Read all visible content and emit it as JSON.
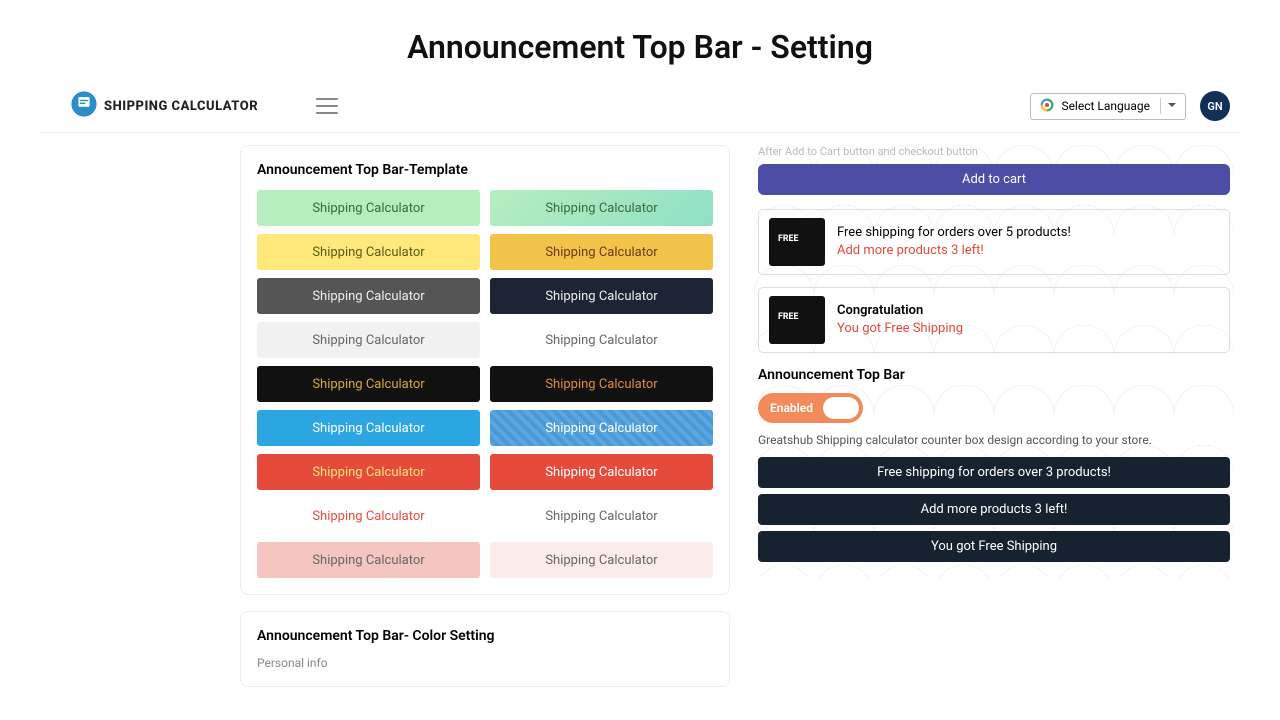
{
  "page_title": "Announcement Top Bar - Setting",
  "header": {
    "logo_text": "Shipping Calculator",
    "lang_label": "Select Language",
    "avatar_initials": "GN"
  },
  "template_card": {
    "title": "Announcement Top Bar-Template",
    "items": [
      {
        "label": "Shipping Calculator"
      },
      {
        "label": "Shipping Calculator"
      },
      {
        "label": "Shipping Calculator"
      },
      {
        "label": "Shipping Calculator"
      },
      {
        "label": "Shipping Calculator"
      },
      {
        "label": "Shipping Calculator"
      },
      {
        "label": "Shipping Calculator"
      },
      {
        "label": "Shipping Calculator"
      },
      {
        "label": "Shipping Calculator"
      },
      {
        "label": "Shipping Calculator"
      },
      {
        "label": "Shipping Calculator"
      },
      {
        "label": "Shipping Calculator"
      },
      {
        "label": "Shipping Calculator"
      },
      {
        "label": "Shipping Calculator"
      },
      {
        "label": "Shipping Calculator"
      },
      {
        "label": "Shipping Calculator"
      },
      {
        "label": "Shipping Calculator"
      },
      {
        "label": "Shipping Calculator"
      }
    ]
  },
  "color_card": {
    "title": "Announcement Top Bar- Color Setting",
    "subtitle": "Personal info"
  },
  "preview": {
    "faded_hint": "After Add to Cart button and checkout button",
    "add_to_cart": "Add to cart",
    "box1_line1": "Free shipping for orders over 5 products!",
    "box1_line2": "Add more products 3 left!",
    "box2_line1": "Congratulation",
    "box2_line2": "You got Free Shipping",
    "section_title": "Announcement Top Bar",
    "toggle_label": "Enabled",
    "toggle_desc": "Greatshub Shipping calculator counter box design according to your store.",
    "bars": [
      "Free shipping for orders over 3 products!",
      "Add more products 3 left!",
      "You got Free Shipping"
    ]
  }
}
